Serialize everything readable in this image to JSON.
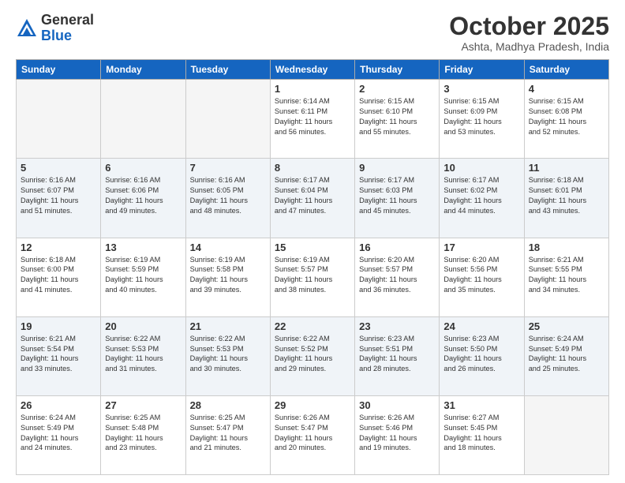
{
  "header": {
    "logo_general": "General",
    "logo_blue": "Blue",
    "month_title": "October 2025",
    "location": "Ashta, Madhya Pradesh, India"
  },
  "weekdays": [
    "Sunday",
    "Monday",
    "Tuesday",
    "Wednesday",
    "Thursday",
    "Friday",
    "Saturday"
  ],
  "weeks": [
    [
      {
        "day": "",
        "info": ""
      },
      {
        "day": "",
        "info": ""
      },
      {
        "day": "",
        "info": ""
      },
      {
        "day": "1",
        "info": "Sunrise: 6:14 AM\nSunset: 6:11 PM\nDaylight: 11 hours\nand 56 minutes."
      },
      {
        "day": "2",
        "info": "Sunrise: 6:15 AM\nSunset: 6:10 PM\nDaylight: 11 hours\nand 55 minutes."
      },
      {
        "day": "3",
        "info": "Sunrise: 6:15 AM\nSunset: 6:09 PM\nDaylight: 11 hours\nand 53 minutes."
      },
      {
        "day": "4",
        "info": "Sunrise: 6:15 AM\nSunset: 6:08 PM\nDaylight: 11 hours\nand 52 minutes."
      }
    ],
    [
      {
        "day": "5",
        "info": "Sunrise: 6:16 AM\nSunset: 6:07 PM\nDaylight: 11 hours\nand 51 minutes."
      },
      {
        "day": "6",
        "info": "Sunrise: 6:16 AM\nSunset: 6:06 PM\nDaylight: 11 hours\nand 49 minutes."
      },
      {
        "day": "7",
        "info": "Sunrise: 6:16 AM\nSunset: 6:05 PM\nDaylight: 11 hours\nand 48 minutes."
      },
      {
        "day": "8",
        "info": "Sunrise: 6:17 AM\nSunset: 6:04 PM\nDaylight: 11 hours\nand 47 minutes."
      },
      {
        "day": "9",
        "info": "Sunrise: 6:17 AM\nSunset: 6:03 PM\nDaylight: 11 hours\nand 45 minutes."
      },
      {
        "day": "10",
        "info": "Sunrise: 6:17 AM\nSunset: 6:02 PM\nDaylight: 11 hours\nand 44 minutes."
      },
      {
        "day": "11",
        "info": "Sunrise: 6:18 AM\nSunset: 6:01 PM\nDaylight: 11 hours\nand 43 minutes."
      }
    ],
    [
      {
        "day": "12",
        "info": "Sunrise: 6:18 AM\nSunset: 6:00 PM\nDaylight: 11 hours\nand 41 minutes."
      },
      {
        "day": "13",
        "info": "Sunrise: 6:19 AM\nSunset: 5:59 PM\nDaylight: 11 hours\nand 40 minutes."
      },
      {
        "day": "14",
        "info": "Sunrise: 6:19 AM\nSunset: 5:58 PM\nDaylight: 11 hours\nand 39 minutes."
      },
      {
        "day": "15",
        "info": "Sunrise: 6:19 AM\nSunset: 5:57 PM\nDaylight: 11 hours\nand 38 minutes."
      },
      {
        "day": "16",
        "info": "Sunrise: 6:20 AM\nSunset: 5:57 PM\nDaylight: 11 hours\nand 36 minutes."
      },
      {
        "day": "17",
        "info": "Sunrise: 6:20 AM\nSunset: 5:56 PM\nDaylight: 11 hours\nand 35 minutes."
      },
      {
        "day": "18",
        "info": "Sunrise: 6:21 AM\nSunset: 5:55 PM\nDaylight: 11 hours\nand 34 minutes."
      }
    ],
    [
      {
        "day": "19",
        "info": "Sunrise: 6:21 AM\nSunset: 5:54 PM\nDaylight: 11 hours\nand 33 minutes."
      },
      {
        "day": "20",
        "info": "Sunrise: 6:22 AM\nSunset: 5:53 PM\nDaylight: 11 hours\nand 31 minutes."
      },
      {
        "day": "21",
        "info": "Sunrise: 6:22 AM\nSunset: 5:53 PM\nDaylight: 11 hours\nand 30 minutes."
      },
      {
        "day": "22",
        "info": "Sunrise: 6:22 AM\nSunset: 5:52 PM\nDaylight: 11 hours\nand 29 minutes."
      },
      {
        "day": "23",
        "info": "Sunrise: 6:23 AM\nSunset: 5:51 PM\nDaylight: 11 hours\nand 28 minutes."
      },
      {
        "day": "24",
        "info": "Sunrise: 6:23 AM\nSunset: 5:50 PM\nDaylight: 11 hours\nand 26 minutes."
      },
      {
        "day": "25",
        "info": "Sunrise: 6:24 AM\nSunset: 5:49 PM\nDaylight: 11 hours\nand 25 minutes."
      }
    ],
    [
      {
        "day": "26",
        "info": "Sunrise: 6:24 AM\nSunset: 5:49 PM\nDaylight: 11 hours\nand 24 minutes."
      },
      {
        "day": "27",
        "info": "Sunrise: 6:25 AM\nSunset: 5:48 PM\nDaylight: 11 hours\nand 23 minutes."
      },
      {
        "day": "28",
        "info": "Sunrise: 6:25 AM\nSunset: 5:47 PM\nDaylight: 11 hours\nand 21 minutes."
      },
      {
        "day": "29",
        "info": "Sunrise: 6:26 AM\nSunset: 5:47 PM\nDaylight: 11 hours\nand 20 minutes."
      },
      {
        "day": "30",
        "info": "Sunrise: 6:26 AM\nSunset: 5:46 PM\nDaylight: 11 hours\nand 19 minutes."
      },
      {
        "day": "31",
        "info": "Sunrise: 6:27 AM\nSunset: 5:45 PM\nDaylight: 11 hours\nand 18 minutes."
      },
      {
        "day": "",
        "info": ""
      }
    ]
  ]
}
